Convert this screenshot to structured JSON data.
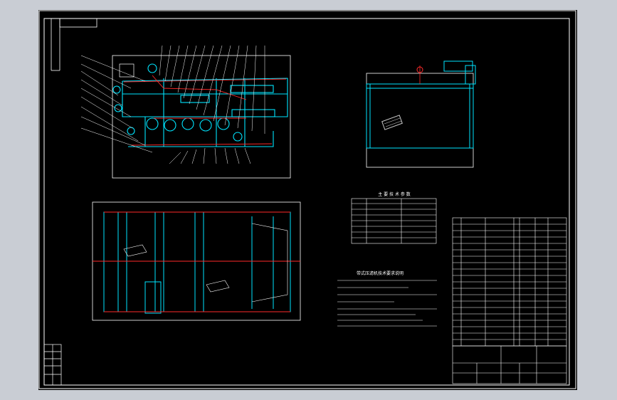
{
  "viewport": {
    "background": "#c9cdd4",
    "drawing_background": "#000000"
  },
  "colors": {
    "frame": "#ffffff",
    "machine": "#00e5ff",
    "accent": "#ff2a2a",
    "label": "#4a6bff"
  },
  "views": {
    "front_elevation": {
      "name": "front-elevation-view"
    },
    "side_elevation": {
      "name": "side-elevation-view"
    },
    "plan_view": {
      "name": "plan-view"
    }
  },
  "tables": {
    "tech_spec": {
      "title": "主 要 技 术 参 数"
    },
    "technical_requirements": {
      "title": "带式压滤机技术要求说明"
    },
    "parts_list": {
      "name": "parts-list"
    },
    "title_block": {
      "name": "title-block"
    }
  }
}
